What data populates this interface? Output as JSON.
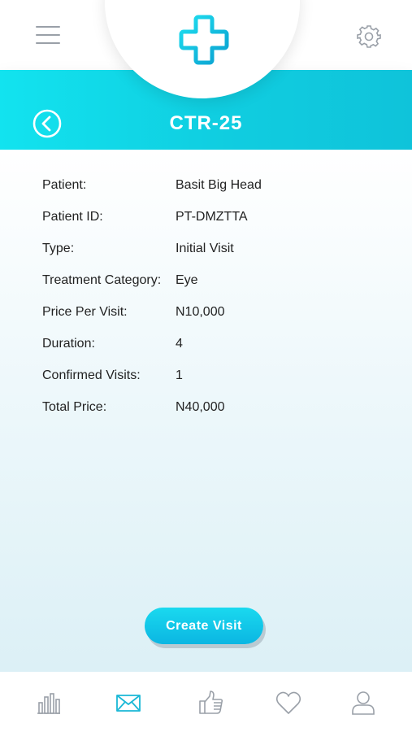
{
  "header": {
    "title": "CTR-25",
    "icons": {
      "menu": "menu-icon",
      "settings": "gear-icon",
      "logo": "medical-cross-logo",
      "back": "back-arrow-icon"
    },
    "accent_color": "#12d8ec"
  },
  "details": [
    {
      "label": "Patient:",
      "value": "Basit Big Head"
    },
    {
      "label": "Patient ID:",
      "value": "PT-DMZTTA"
    },
    {
      "label": "Type:",
      "value": "Initial Visit"
    },
    {
      "label": "Treatment Category:",
      "value": "Eye"
    },
    {
      "label": "Price Per Visit:",
      "value": "N10,000"
    },
    {
      "label": "Duration:",
      "value": "4"
    },
    {
      "label": "Confirmed Visits:",
      "value": "1"
    },
    {
      "label": "Total Price:",
      "value": "N40,000"
    }
  ],
  "actions": {
    "create_visit_label": "Create Visit"
  },
  "bottom_nav": {
    "items": [
      {
        "icon": "bar-chart-icon",
        "active": false
      },
      {
        "icon": "envelope-icon",
        "active": true
      },
      {
        "icon": "thumbs-up-icon",
        "active": false
      },
      {
        "icon": "heart-icon",
        "active": false
      },
      {
        "icon": "user-icon",
        "active": false
      }
    ],
    "active_color": "#1ab8d6",
    "inactive_color": "#9aa0a8"
  }
}
